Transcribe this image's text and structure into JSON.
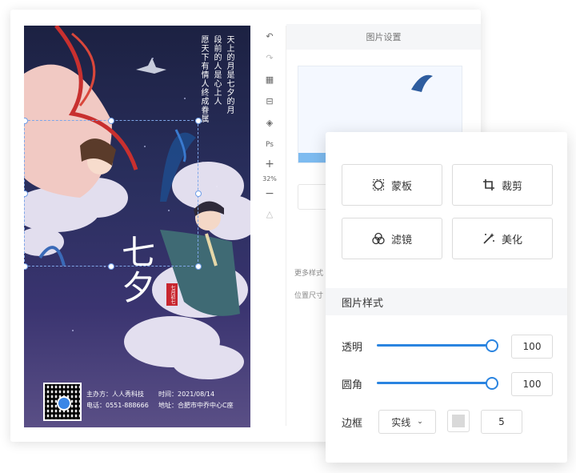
{
  "poster": {
    "poem_lines": [
      "天上的月是七夕的月",
      "段前的人是心上人",
      "愿天下有情人终成眷属"
    ],
    "big_title": "七夕",
    "seal_text": "七月初七",
    "organizer": "主办方：人人秀科技",
    "time": "时间：2021/08/14",
    "phone": "电话：0551-888666",
    "address": "地址：合肥市中乔中心C座"
  },
  "toolbar": {
    "undo": "↶",
    "redo": "↷",
    "grid": "▦",
    "align": "⊟",
    "layers": "◈",
    "ps_label": "Ps",
    "zoom_in": "+",
    "zoom_level": "32%",
    "zoom_out": "−",
    "warning": "△"
  },
  "right_panel": {
    "title": "图片设置",
    "more_styles": "更多样式",
    "position_size": "位置尺寸"
  },
  "popup": {
    "buttons": [
      {
        "label": "蒙板",
        "icon": "mask-icon"
      },
      {
        "label": "裁剪",
        "icon": "crop-icon"
      },
      {
        "label": "滤镜",
        "icon": "filter-icon"
      },
      {
        "label": "美化",
        "icon": "beautify-icon"
      }
    ],
    "style_section": "图片样式",
    "opacity_label": "透明",
    "opacity_value": "100",
    "opacity_fraction": 1.0,
    "radius_label": "圆角",
    "radius_value": "100",
    "radius_fraction": 1.0,
    "border_label": "边框",
    "border_style": "实线",
    "border_width": "5",
    "border_color": "#d9d9d9",
    "accent_color": "#2a84e0"
  }
}
